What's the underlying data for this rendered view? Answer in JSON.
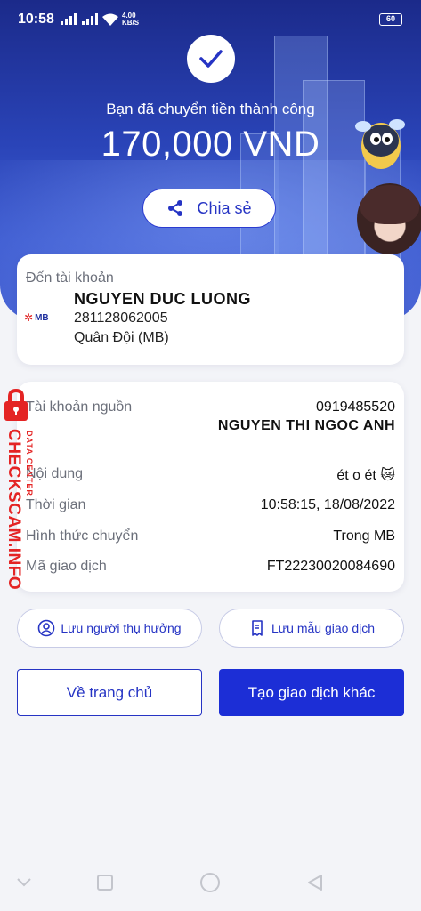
{
  "status_bar": {
    "time": "10:58",
    "net_speed_value": "4.00",
    "net_speed_unit": "KB/S",
    "battery": "60"
  },
  "success": {
    "message": "Bạn đã chuyển tiền thành công",
    "amount": "170,000 VND",
    "share_label": "Chia sẻ"
  },
  "destination": {
    "label": "Đến tài khoản",
    "bank_logo_text": "MB",
    "name": "NGUYEN DUC LUONG",
    "account_number": "281128062005",
    "bank": "Quân Đội (MB)"
  },
  "details": {
    "source_account_label": "Tài khoản nguồn",
    "source_account_number": "0919485520",
    "source_name": "NGUYEN THI NGOC ANH",
    "content_label": "Nội dung",
    "content_value": "ét o ét 😿",
    "time_label": "Thời gian",
    "time_value": "10:58:15, 18/08/2022",
    "method_label": "Hình thức chuyển",
    "method_value": "Trong MB",
    "transaction_id_label": "Mã giao dịch",
    "transaction_id_value": "FT22230020084690"
  },
  "actions": {
    "save_beneficiary": "Lưu người thụ hưởng",
    "save_template": "Lưu mẫu giao dịch",
    "home": "Về trang chủ",
    "new_transaction": "Tạo giao dịch khác"
  },
  "watermark": {
    "main": "CHECKSCAM.INFO",
    "sub": "DATA CENTER"
  },
  "colors": {
    "primary": "#1c2ed6",
    "hero": "#2a44b8",
    "watermark": "#e42424",
    "background": "#f3f4f8"
  }
}
